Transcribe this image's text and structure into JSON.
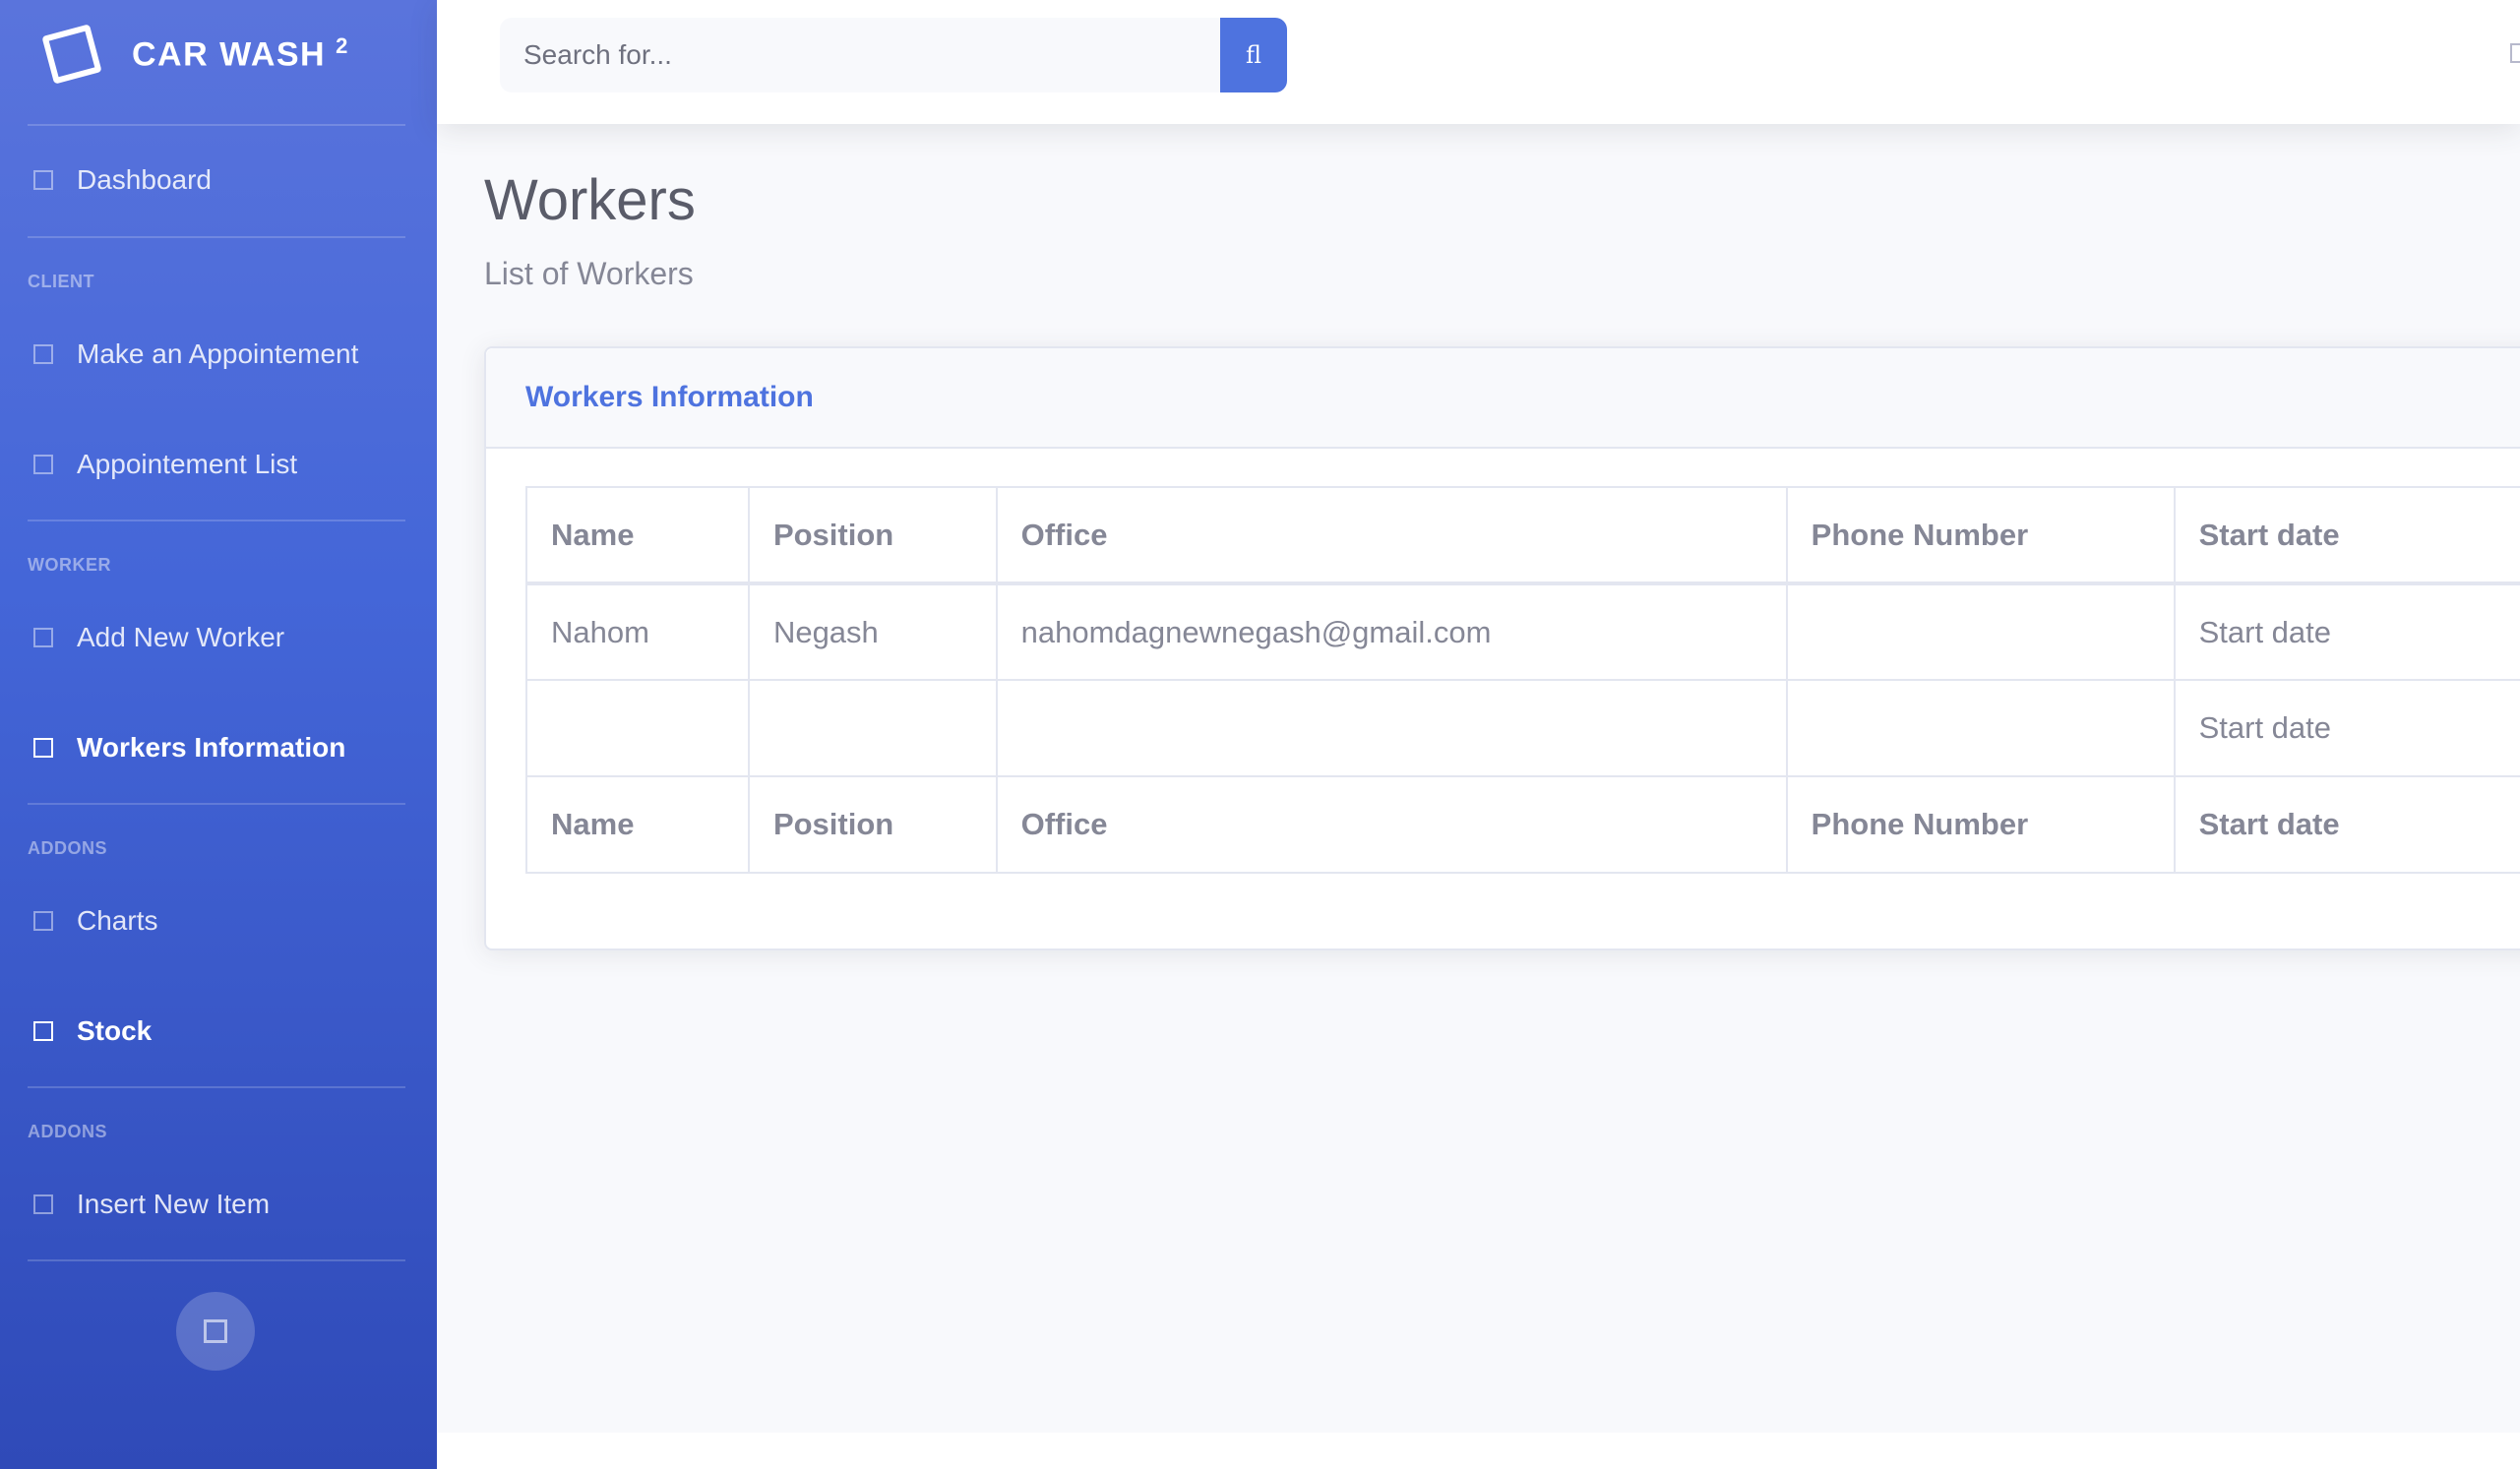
{
  "brand": {
    "name": "Car Wash",
    "sup": "2"
  },
  "sidebar": {
    "dashboard": "Dashboard",
    "headings": [
      "Client",
      "Worker",
      "Addons",
      "Addons"
    ],
    "items": [
      {
        "label": "Make an Appointement"
      },
      {
        "label": "Appointement List"
      },
      {
        "label": "Add New Worker"
      },
      {
        "label": "Workers Information",
        "active": true
      },
      {
        "label": "Charts"
      },
      {
        "label": "Stock",
        "active": true
      },
      {
        "label": "Insert New Item"
      }
    ]
  },
  "search": {
    "placeholder": "Search for...",
    "button_glyph": "fl"
  },
  "page": {
    "title": "Workers",
    "subtitle": "List of Workers"
  },
  "card": {
    "title": "Workers Information",
    "table": {
      "columns": [
        "Name",
        "Position",
        "Office",
        "Phone Number",
        "Start date"
      ],
      "rows": [
        [
          "Nahom",
          "Negash",
          "nahomdagnewnegash@gmail.com",
          "",
          "Start date"
        ],
        [
          "",
          "",
          "",
          "",
          "Start date"
        ]
      ],
      "footer": [
        "Name",
        "Position",
        "Office",
        "Phone Number",
        "Start date"
      ]
    }
  },
  "colors": {
    "primary": "#4e73df",
    "sidebar": "#4e73df",
    "bg": "#f8f9fc",
    "text": "#858796"
  }
}
